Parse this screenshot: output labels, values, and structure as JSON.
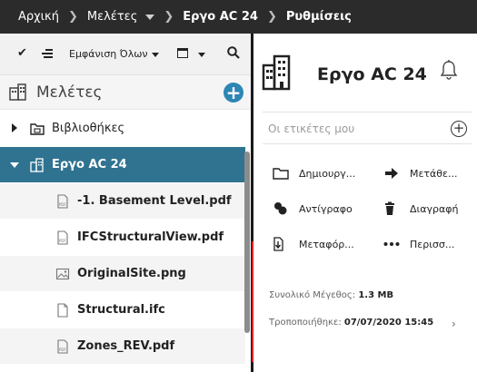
{
  "breadcrumb": {
    "items": [
      "Αρχική",
      "Μελέτες",
      "Εργο AC 24",
      "Ρυθμίσεις"
    ]
  },
  "toolbar": {
    "filter_label": "Εμφάνιση Όλων"
  },
  "projects": {
    "title": "Μελέτες"
  },
  "tree": {
    "items": [
      {
        "label": "Βιβλιοθήκες"
      },
      {
        "label": "Εργο AC 24"
      },
      {
        "label": "-1. Basement Level.pdf"
      },
      {
        "label": "IFCStructuralView.pdf"
      },
      {
        "label": "OriginalSite.png"
      },
      {
        "label": "Structural.ifc"
      },
      {
        "label": "Zones_REV.pdf"
      }
    ]
  },
  "details": {
    "title": "Εργο AC 24",
    "tags_placeholder": "Οι ετικέτες μου",
    "actions": [
      {
        "label": "Δημιουργ...",
        "icon": "folder-icon"
      },
      {
        "label": "Μετάθε...",
        "icon": "arrow-right-icon"
      },
      {
        "label": "Αντίγραφο",
        "icon": "copy-icon"
      },
      {
        "label": "Διαγραφή",
        "icon": "trash-icon"
      },
      {
        "label": "Μεταφόρ...",
        "icon": "download-icon"
      },
      {
        "label": "Περισσ...",
        "icon": "more-icon"
      }
    ],
    "size_label": "Συνολικό Μέγεθος:",
    "size_value": "1.3 MB",
    "modified_label": "Τροποποιήθηκε:",
    "modified_value": "07/07/2020 15:45"
  },
  "colors": {
    "topbar": "#2b2b2b",
    "selected_row": "#2f7390",
    "add_button": "#2d86b4",
    "highlight_border": "#e02020"
  }
}
